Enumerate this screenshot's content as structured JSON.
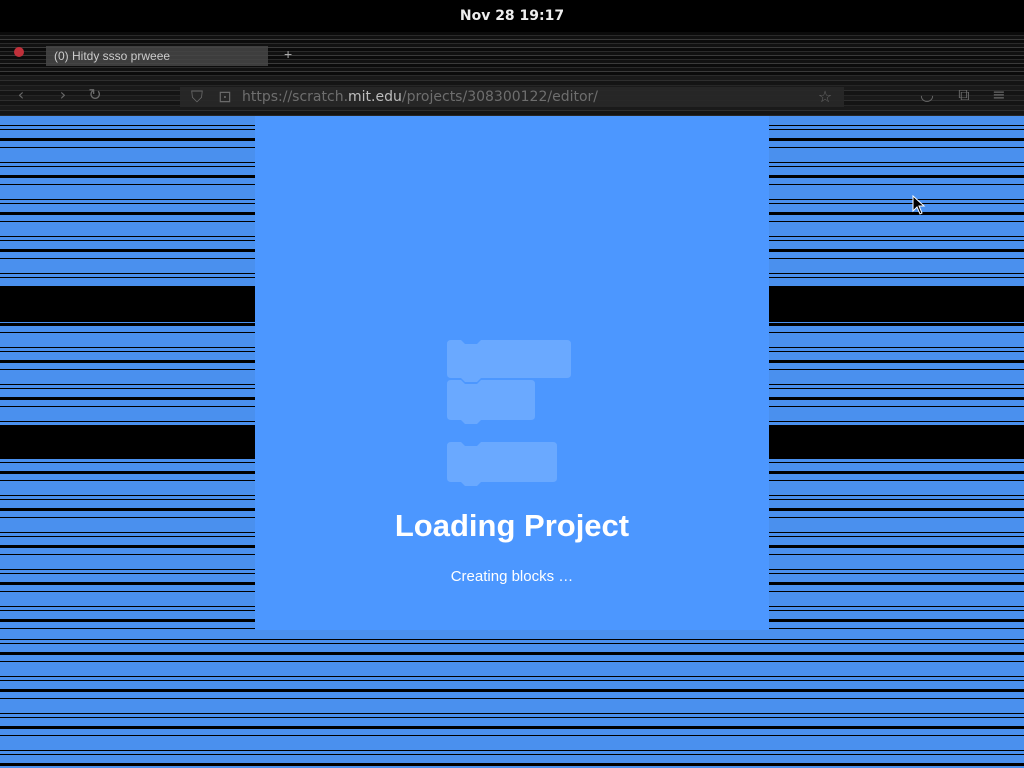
{
  "system": {
    "clock": "Nov 28  19:17"
  },
  "browser": {
    "tab_title": "(0) Hitdy ssso prweee",
    "new_tab_icon": "plus-icon",
    "url_prefix": "https://scratch.",
    "url_host": "mit.edu",
    "url_path": "/projects/308300122/editor/",
    "back_icon": "back-arrow-icon",
    "forward_icon": "forward-arrow-icon",
    "reload_icon": "reload-icon",
    "shield_icon": "shield-icon",
    "lock_icon": "lock-icon",
    "bookmark_icon": "star-icon",
    "pocket_icon": "pocket-icon",
    "extensions_icon": "extensions-icon",
    "menu_icon": "hamburger-menu-icon"
  },
  "loader": {
    "title": "Loading Project",
    "status": "Creating blocks …",
    "icon": "blocks-stack-icon"
  },
  "colors": {
    "accent": "#4c97ff",
    "background_stripe": "#4a90ee"
  }
}
